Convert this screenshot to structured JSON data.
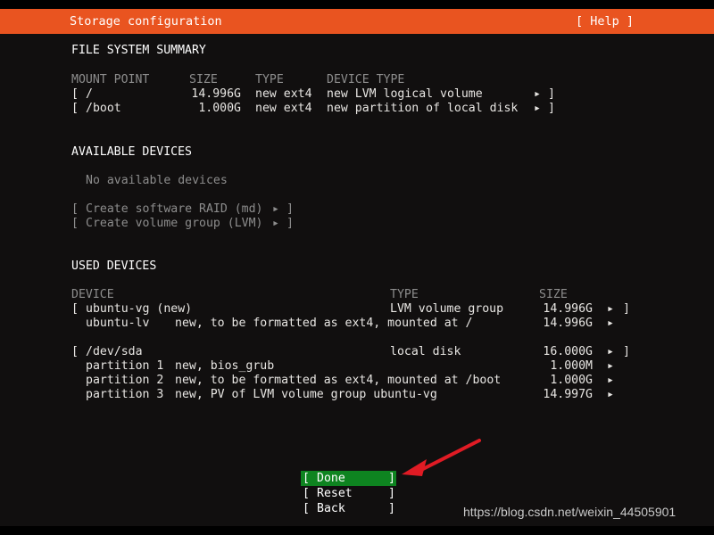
{
  "colors": {
    "header_bg": "#e95420",
    "screen_bg": "#110f0f",
    "selected_bg": "#0e8420",
    "text": "#e8e6e3",
    "dim_text": "#8d8d8d",
    "arrow": "#e01b24"
  },
  "header": {
    "title": "Storage configuration",
    "help_label": "[ Help ]"
  },
  "file_system_summary": {
    "section_title": "FILE SYSTEM SUMMARY",
    "columns": {
      "mount_point": "MOUNT POINT",
      "size": "SIZE",
      "type": "TYPE",
      "device_type": "DEVICE TYPE"
    },
    "rows": [
      {
        "open_bracket": "[",
        "mount_point": "/",
        "size": "14.996G",
        "type": "new ext4",
        "device_type": "new LVM logical volume",
        "arrow": "▸",
        "close_bracket": "]"
      },
      {
        "open_bracket": "[",
        "mount_point": "/boot",
        "size": "1.000G",
        "type": "new ext4",
        "device_type": "new partition of local disk",
        "arrow": "▸",
        "close_bracket": "]"
      }
    ]
  },
  "available_devices": {
    "section_title": "AVAILABLE DEVICES",
    "empty_message": "No available devices",
    "actions": [
      {
        "open_bracket": "[",
        "label": "Create software RAID (md)",
        "arrow": "▸",
        "close_bracket": "]"
      },
      {
        "open_bracket": "[",
        "label": "Create volume group (LVM)",
        "arrow": "▸",
        "close_bracket": "]"
      }
    ]
  },
  "used_devices": {
    "section_title": "USED DEVICES",
    "columns": {
      "device": "DEVICE",
      "type": "TYPE",
      "size": "SIZE"
    },
    "groups": [
      {
        "header": {
          "open_bracket": "[",
          "device": "ubuntu-vg (new)",
          "type": "LVM volume group",
          "size": "14.996G",
          "arrow": "▸",
          "close_bracket": "]"
        },
        "children": [
          {
            "device": "ubuntu-lv",
            "type": "new, to be formatted as ext4, mounted at /",
            "size": "14.996G",
            "arrow": "▸"
          }
        ]
      },
      {
        "header": {
          "open_bracket": "[",
          "device": "/dev/sda",
          "type": "local disk",
          "size": "16.000G",
          "arrow": "▸",
          "close_bracket": "]"
        },
        "children": [
          {
            "device": "partition 1",
            "type": "new, bios_grub",
            "size": "1.000M",
            "arrow": "▸"
          },
          {
            "device": "partition 2",
            "type": "new, to be formatted as ext4, mounted at /boot",
            "size": "1.000G",
            "arrow": "▸"
          },
          {
            "device": "partition 3",
            "type": "new, PV of LVM volume group ubuntu-vg",
            "size": "14.997G",
            "arrow": "▸"
          }
        ]
      }
    ]
  },
  "buttons": [
    {
      "open_bracket": "[",
      "label": "Done",
      "close_bracket": "]",
      "selected": true
    },
    {
      "open_bracket": "[",
      "label": "Reset",
      "close_bracket": "]",
      "selected": false
    },
    {
      "open_bracket": "[",
      "label": "Back",
      "close_bracket": "]",
      "selected": false
    }
  ],
  "annotation": {
    "arrow_name": "red-pointer-arrow"
  },
  "watermark": {
    "text": "https://blog.csdn.net/weixin_44505901"
  }
}
